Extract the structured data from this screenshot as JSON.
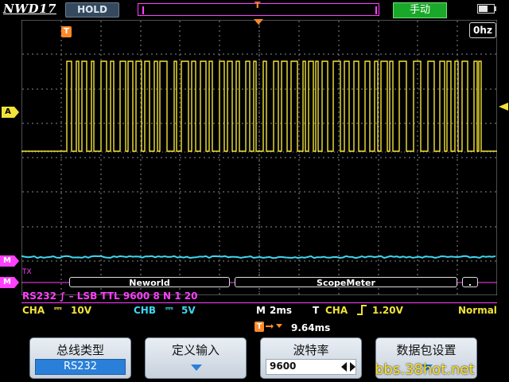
{
  "header": {
    "brand": "NWD17",
    "hold_label": "HOLD",
    "trigger_marker": "T",
    "mode_label": "手动"
  },
  "display": {
    "frequency": "0hz",
    "trigger_flag": "T",
    "channel_a_marker": "A",
    "math_marker_1": "M",
    "math_marker_2": "M",
    "tx_label": "TX",
    "packets": [
      "Neworld",
      "ScopeMeter",
      "."
    ]
  },
  "decode": {
    "config": "RS232 ∫ – LSB TTL 9600 8 N 1 20"
  },
  "status": {
    "cha_label": "CHA",
    "cha_scale": "10V",
    "chb_label": "CHB",
    "chb_scale": "5V",
    "timebase_label": "M",
    "timebase": "2ms",
    "trigger_label": "T",
    "trigger_source": "CHA",
    "trigger_level": "1.20V",
    "trigger_mode": "Normal",
    "delay_label": "T",
    "delay": "9.64ms"
  },
  "softkeys": [
    {
      "label": "总线类型",
      "value": "RS232"
    },
    {
      "label": "定义输入",
      "value": ""
    },
    {
      "label": "波特率",
      "value": "9600"
    },
    {
      "label": "数据包设置",
      "value": ""
    }
  ],
  "watermark": "bbs.38hot.net",
  "colors": {
    "channel_a": "#f2e33a",
    "channel_b": "#3fd6f0",
    "math": "#ff40ff",
    "trigger": "#ff8a2a",
    "mode_button": "#1aa82a",
    "selected_value": "#2a7fd8"
  },
  "icons": {
    "trigger_edge": "rising-edge-icon",
    "delay_arrow": "arrow-down-icon",
    "dropdown": "triangle-down-icon",
    "stepper": "left-right-arrows-icon",
    "battery": "battery-icon"
  }
}
